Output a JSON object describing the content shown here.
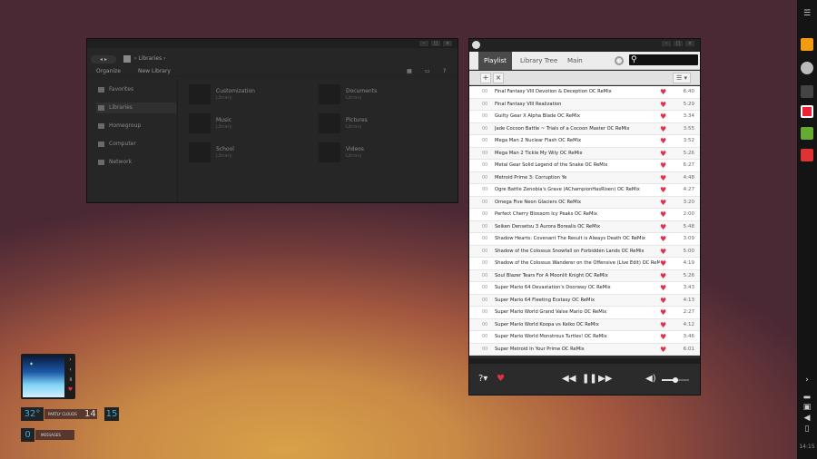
{
  "explorer": {
    "breadcrumb": "Libraries",
    "toolbar": {
      "organize": "Organize",
      "new_library": "New Library"
    },
    "sidebar": [
      "Favorites",
      "Libraries",
      "Homegroup",
      "Computer",
      "Network"
    ],
    "libraries": [
      {
        "name": "Customization",
        "type": "Library"
      },
      {
        "name": "Documents",
        "type": "Library"
      },
      {
        "name": "Music",
        "type": "Library"
      },
      {
        "name": "Pictures",
        "type": "Library"
      },
      {
        "name": "School",
        "type": "Library"
      },
      {
        "name": "Videos",
        "type": "Library"
      }
    ]
  },
  "player": {
    "tabs": [
      "Playlist",
      "Library Tree",
      "Main"
    ],
    "search_placeholder": "",
    "actions": {
      "add": "+",
      "remove": "×",
      "menu": "☰"
    },
    "tracks": [
      {
        "num": "00",
        "title": "Final Fantasy VIII Devotion & Deception OC ReMix",
        "duration": "6:40"
      },
      {
        "num": "00",
        "title": "Final Fantasy VIII Realization",
        "duration": "5:29"
      },
      {
        "num": "00",
        "title": "Guilty Gear X Alpha Blade OC ReMix",
        "duration": "3:34"
      },
      {
        "num": "00",
        "title": "Jade Cocoon Battle ~ Trials of a Cocoon Master OC ReMix",
        "duration": "3:55"
      },
      {
        "num": "00",
        "title": "Mega Man 2 Nuclear Flash OC ReMix",
        "duration": "3:52"
      },
      {
        "num": "00",
        "title": "Mega Man 2 Tickle My Wily OC ReMix",
        "duration": "5:26"
      },
      {
        "num": "00",
        "title": "Metal Gear Solid Legend of the Snake OC ReMix",
        "duration": "6:27"
      },
      {
        "num": "00",
        "title": "Metroid Prime 3: Corruption Ye",
        "duration": "4:48"
      },
      {
        "num": "00",
        "title": "Ogre Battle Zenobia's Grave (AChampionHasRisen) OC ReMix",
        "duration": "4:27"
      },
      {
        "num": "00",
        "title": "Omega Five Neon Glaciers OC ReMix",
        "duration": "3:20"
      },
      {
        "num": "00",
        "title": "Perfect Cherry Blossom Icy Peaks OC ReMix",
        "duration": "2:00"
      },
      {
        "num": "00",
        "title": "Seiken Densetsu 3 Aurora Borealis OC ReMix",
        "duration": "5:48"
      },
      {
        "num": "00",
        "title": "Shadow Hearts: Covenant The Result is Always Death OC ReMix",
        "duration": "3:09"
      },
      {
        "num": "00",
        "title": "Shadow of the Colossus Snowfall on Forbidden Lands OC ReMix",
        "duration": "5:00"
      },
      {
        "num": "00",
        "title": "Shadow of the Colossus Wanderer on the Offensive (Live Edit) OC ReMix",
        "duration": "4:19"
      },
      {
        "num": "00",
        "title": "Soul Blazer Tears For A Moonlit Knight OC ReMix",
        "duration": "5:26"
      },
      {
        "num": "00",
        "title": "Super Mario 64 Devastation's Doorway OC ReMix",
        "duration": "3:43"
      },
      {
        "num": "00",
        "title": "Super Mario 64 Fleeting Ecstasy OC ReMix",
        "duration": "4:13"
      },
      {
        "num": "00",
        "title": "Super Mario World Grand Valse Mario OC ReMix",
        "duration": "2:27"
      },
      {
        "num": "00",
        "title": "Super Mario World Koopa vs Keiko OC ReMix",
        "duration": "4:12"
      },
      {
        "num": "00",
        "title": "Super Mario World Monstrous Turtles! OC ReMix",
        "duration": "3:46"
      },
      {
        "num": "00",
        "title": "Super Metroid In Your Prime OC ReMix",
        "duration": "6:01"
      }
    ],
    "volume_level": 0.5,
    "heart_color": "#e0304a"
  },
  "widgets": {
    "weather": {
      "temp": "32°",
      "condition": "PARTLY CLOUDS",
      "high": "14",
      "low": "15"
    },
    "mail": {
      "count": "0",
      "label": "MESSAGES"
    },
    "accent": "#39a8dc"
  },
  "taskbar": {
    "clock": "14:15"
  }
}
